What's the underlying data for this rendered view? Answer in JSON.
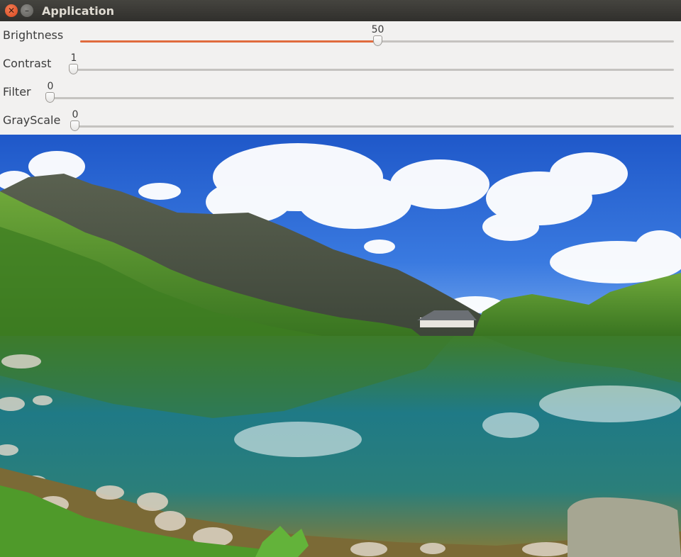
{
  "window": {
    "title": "Application"
  },
  "sliders": [
    {
      "label": "Brightness",
      "value": "50",
      "min": 0,
      "max": 100,
      "fraction": 0.5
    },
    {
      "label": "Contrast",
      "value": "1",
      "min": 1,
      "max": 100,
      "fraction": 0.0
    },
    {
      "label": "Filter",
      "value": "0",
      "min": 0,
      "max": 100,
      "fraction": 0.0
    },
    {
      "label": "GrayScale",
      "value": "0",
      "min": 0,
      "max": 100,
      "fraction": 0.0
    }
  ],
  "colors": {
    "accent": "#e06b3e",
    "panel": "#f2f1f0",
    "titlebar": "#3c3b37"
  },
  "image": {
    "subject": "mountain lake landscape"
  }
}
